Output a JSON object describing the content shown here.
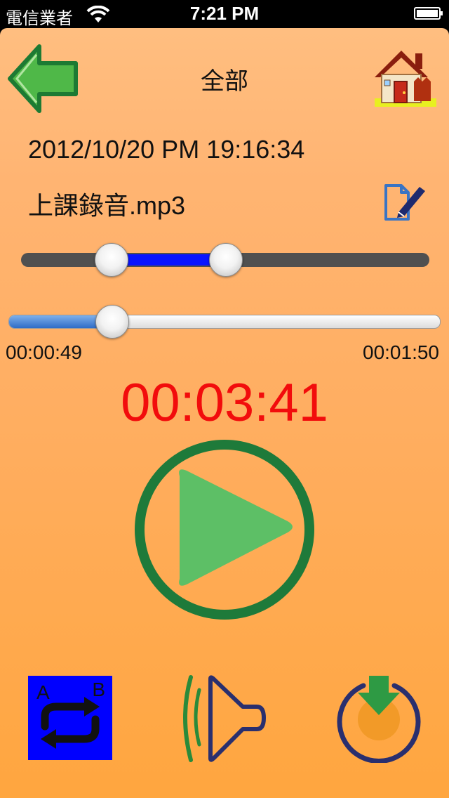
{
  "status_bar": {
    "carrier": "電信業者",
    "time": "7:21 PM",
    "wifi_icon": "wifi-icon",
    "battery_icon": "battery-icon"
  },
  "header": {
    "title": "全部",
    "back_icon": "arrow-left-icon",
    "home_icon": "house-icon"
  },
  "recording": {
    "datetime": "2012/10/20 PM 19:16:34",
    "filename": "上課錄音.mp3",
    "edit_icon": "edit-document-icon"
  },
  "playback": {
    "start_time": "00:00:49",
    "end_time": "00:01:50",
    "total_time": "00:03:41",
    "progress_fraction": 0.24,
    "range_start_fraction": 0.22,
    "range_end_fraction": 0.5,
    "play_icon": "play-icon"
  },
  "controls": {
    "ab_label_a": "A",
    "ab_label_b": "B",
    "ab_icon": "repeat-icon",
    "volume_icon": "speaker-icon",
    "download_icon": "download-icon"
  },
  "colors": {
    "background": "#ffad5e",
    "total_time": "#f20c0c",
    "range_fill": "#0a14ff",
    "play_ring": "#1e7a3a",
    "play_triangle": "#5dbf66",
    "ab_background": "#0000ff"
  }
}
